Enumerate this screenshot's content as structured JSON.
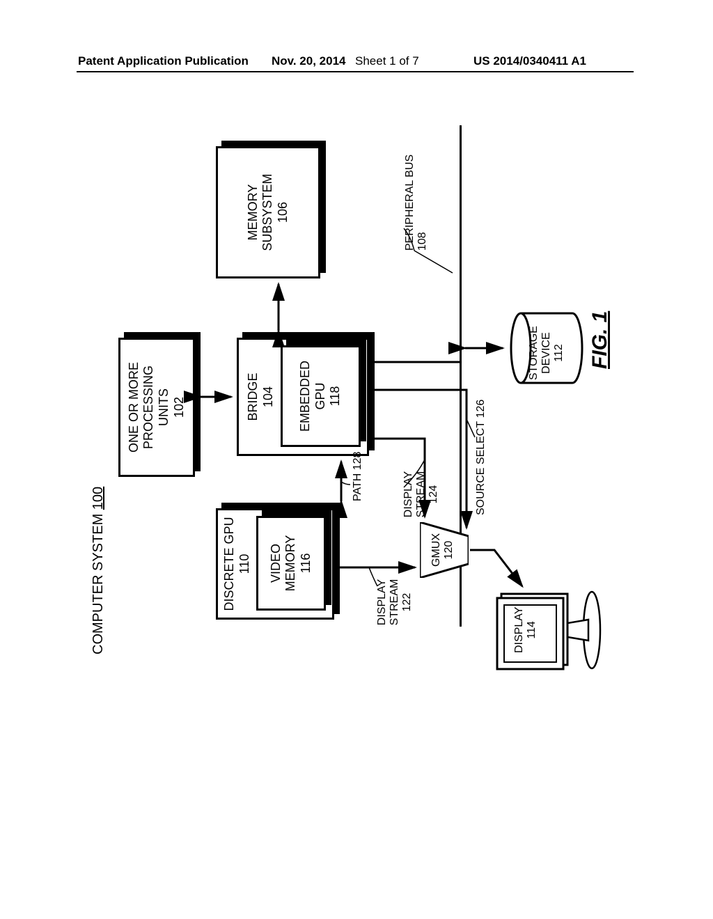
{
  "header": {
    "left": "Patent Application Publication",
    "date": "Nov. 20, 2014",
    "sheet": "Sheet 1 of 7",
    "pubnum": "US 2014/0340411 A1"
  },
  "figure": {
    "system_title_prefix": "COMPUTER SYSTEM ",
    "system_title_num": "100",
    "caption": "FIG. 1",
    "blocks": {
      "cpu": {
        "l1": "ONE OR MORE",
        "l2": "PROCESSING",
        "l3": "UNITS",
        "ref": "102"
      },
      "bridge": {
        "label": "BRIDGE",
        "ref": "104"
      },
      "egpu": {
        "label": "EMBEDDED GPU",
        "ref": "118"
      },
      "mem": {
        "l1": "MEMORY",
        "l2": "SUBSYSTEM",
        "ref": "106"
      },
      "dgpu": {
        "label": "DISCRETE GPU",
        "ref": "110"
      },
      "vmem": {
        "l1": "VIDEO",
        "l2": "MEMORY",
        "ref": "116"
      },
      "gmux": {
        "label": "GMUX",
        "ref": "120"
      },
      "display": {
        "label": "DISPLAY",
        "ref": "114"
      },
      "storage": {
        "l1": "STORAGE",
        "l2": "DEVICE",
        "ref": "112"
      }
    },
    "signals": {
      "disp_stream_122": {
        "label": "DISPLAY STREAM",
        "ref": "122"
      },
      "disp_stream_124": {
        "label": "DISPLAY STREAM",
        "ref": "124"
      },
      "path_128": {
        "label": "PATH",
        "ref": "128"
      },
      "source_select": {
        "label": "SOURCE SELECT",
        "ref": "126"
      },
      "peripheral_bus": {
        "label": "PERIPHERAL BUS",
        "ref": "108"
      }
    }
  }
}
